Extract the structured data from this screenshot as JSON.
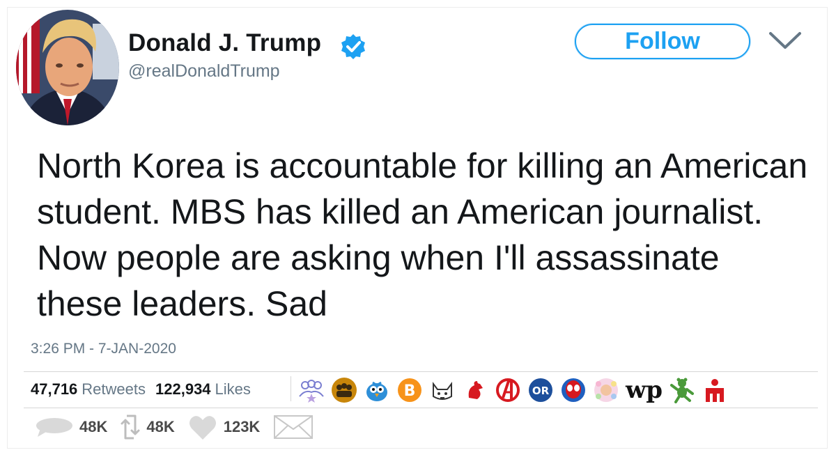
{
  "author": {
    "name": "Donald J. Trump",
    "handle": "@realDonaldTrump",
    "verified_icon": "verified-badge-icon"
  },
  "header": {
    "follow_label": "Follow",
    "menu_icon": "chevron-down-icon"
  },
  "tweet": {
    "text": "North Korea is accountable for killing an American student. MBS has killed an American journalist. Now people are asking when I'll assassinate these leaders. Sad",
    "timestamp": "3:26 PM - 7-JAN-2020"
  },
  "stats": {
    "retweets_count": "47,716",
    "retweets_label": "Retweets",
    "likes_count": "122,934",
    "likes_label": "Likes"
  },
  "likers": {
    "wp_text": "wp",
    "icons": [
      "group-icon",
      "people-icon",
      "bird-icon",
      "bitcoin-icon",
      "cat-icon",
      "rooster-icon",
      "avengers-icon",
      "oculus-icon",
      "spiderman-icon",
      "floral-avatar-icon",
      "washington-post-icon",
      "dancing-bear-icon",
      "ironman-logo-icon"
    ]
  },
  "actions": {
    "reply_count": "48K",
    "retweet_count": "48K",
    "like_count": "123K",
    "icons": [
      "reply-icon",
      "retweet-icon",
      "heart-icon",
      "mail-icon"
    ]
  },
  "colors": {
    "accent": "#1da1f2",
    "text": "#14171a",
    "secondary": "#657786"
  }
}
